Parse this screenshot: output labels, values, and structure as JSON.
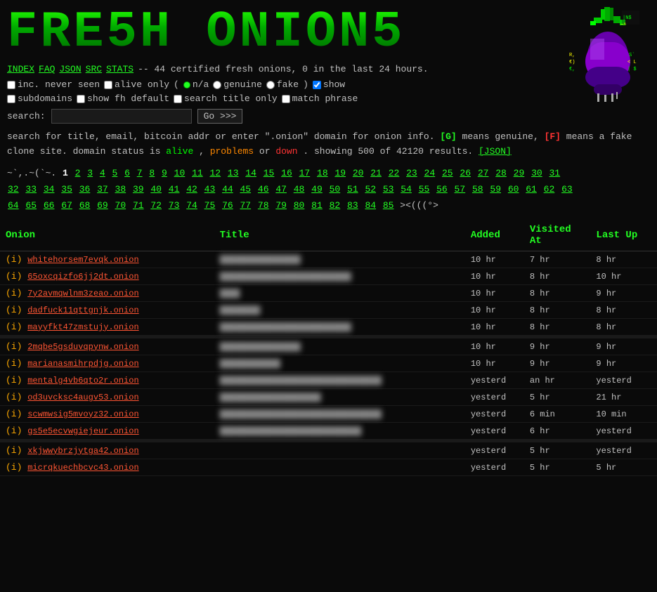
{
  "logo": {
    "text": "FRE5H ONiON5"
  },
  "navbar": {
    "links": [
      "INDEX",
      "FAQ",
      "JSON",
      "SRC",
      "STATS"
    ],
    "info": "-- 44 certified fresh onions, 0 in the last 24 hours."
  },
  "options": {
    "inc_never_seen": false,
    "alive_only": false,
    "radio_na": true,
    "radio_genuine": false,
    "radio_fake": false,
    "show_checked": true,
    "show_label": "show",
    "subdomains_label": "subdomains",
    "show_fh": false,
    "show_fh_label": "show fh default",
    "search_title": false,
    "search_title_label": "search title only",
    "match_phrase": false,
    "match_phrase_label": "match phrase"
  },
  "search": {
    "label": "search:",
    "placeholder": "",
    "value": "",
    "button": "Go >>>"
  },
  "info": {
    "line1": "search for title, email, bitcoin addr or enter \".onion\" domain for onion info.",
    "genuine_badge": "[G]",
    "genuine_desc": "means genuine,",
    "fake_badge": "[F]",
    "fake_desc": "means a fake clone site. domain status is",
    "alive": "alive",
    "problems": "problems",
    "or": "or",
    "down": "down",
    "showing": ". showing 500 of 42120 results.",
    "json_link": "[JSON]"
  },
  "pagination": {
    "prefix": "~`,.~(`~. 1",
    "pages": [
      "2",
      "3",
      "4",
      "5",
      "6",
      "7",
      "8",
      "9",
      "10",
      "11",
      "12",
      "13",
      "14",
      "15",
      "16",
      "17",
      "18",
      "19",
      "20",
      "21",
      "22",
      "23",
      "24",
      "25",
      "26",
      "27",
      "28",
      "29",
      "30",
      "31",
      "32",
      "33",
      "34",
      "35",
      "36",
      "37",
      "38",
      "39",
      "40",
      "41",
      "42",
      "43",
      "44",
      "45",
      "46",
      "47",
      "48",
      "49",
      "50",
      "51",
      "52",
      "53",
      "54",
      "55",
      "56",
      "57",
      "58",
      "59",
      "60",
      "61",
      "62",
      "63",
      "64",
      "65",
      "66",
      "67",
      "68",
      "69",
      "70",
      "71",
      "72",
      "73",
      "74",
      "75",
      "76",
      "77",
      "78",
      "79",
      "80",
      "81",
      "82",
      "83",
      "84",
      "85"
    ],
    "suffix": "><(((°>"
  },
  "table": {
    "headers": [
      "Onion",
      "Title",
      "Added",
      "Visited At",
      "Last Up"
    ],
    "rows": [
      {
        "id": "i1",
        "onion": "whitehorsem7evqk.onion",
        "title_blurred": true,
        "title": "████████████████",
        "added": "10 hr",
        "visited": "7 hr",
        "last_up": "8 hr",
        "status": "alive"
      },
      {
        "id": "i2",
        "onion": "65oxcqizfo6jj2dt.onion",
        "title_blurred": true,
        "title": "██████████████████████████",
        "added": "10 hr",
        "visited": "8 hr",
        "last_up": "10 hr",
        "status": "alive"
      },
      {
        "id": "i3",
        "onion": "7y2avmqwlnm3zeao.onion",
        "title_blurred": true,
        "title": "████",
        "added": "10 hr",
        "visited": "8 hr",
        "last_up": "9 hr",
        "status": "alive"
      },
      {
        "id": "i4",
        "onion": "dadfuck11qttgnjk.onion",
        "title_blurred": true,
        "title": "████████",
        "added": "10 hr",
        "visited": "8 hr",
        "last_up": "8 hr",
        "status": "alive"
      },
      {
        "id": "i5",
        "onion": "mayyfkt47zmstujy.onion",
        "title_blurred": true,
        "title": "██████████████████████████",
        "added": "10 hr",
        "visited": "8 hr",
        "last_up": "8 hr",
        "status": "alive"
      },
      {
        "id": "divider1",
        "divider": true
      },
      {
        "id": "i6",
        "onion": "2mqbe5gsduvqpynw.onion",
        "title_blurred": true,
        "title": "████████████████",
        "added": "10 hr",
        "visited": "9 hr",
        "last_up": "9 hr",
        "status": "alive"
      },
      {
        "id": "i7",
        "onion": "marianasmihrpdjg.onion",
        "title_blurred": true,
        "title": "████████████",
        "added": "10 hr",
        "visited": "9 hr",
        "last_up": "9 hr",
        "status": "alive"
      },
      {
        "id": "i8",
        "onion": "mentalg4vb6qto2r.onion",
        "title_blurred": true,
        "title": "████████████████████████████████",
        "added": "yesterd",
        "visited": "an hr",
        "last_up": "yesterd",
        "status": "alive"
      },
      {
        "id": "i9",
        "onion": "od3uvcksc4augv53.onion",
        "title_blurred": true,
        "title": "████████████████████",
        "added": "yesterd",
        "visited": "5 hr",
        "last_up": "21 hr",
        "status": "alive"
      },
      {
        "id": "i10",
        "onion": "scwmwsig5mvoyz32.onion",
        "title_blurred": true,
        "title": "████████████████████████████████",
        "added": "yesterd",
        "visited": "6 min",
        "last_up": "10 min",
        "status": "alive"
      },
      {
        "id": "i11",
        "onion": "gs5e5ecvwgiejeur.onion",
        "title_blurred": true,
        "title": "████████████████████████████",
        "added": "yesterd",
        "visited": "6 hr",
        "last_up": "yesterd",
        "status": "alive"
      },
      {
        "id": "divider2",
        "divider": true
      },
      {
        "id": "i12",
        "onion": "xkjwwybrzjytga42.onion",
        "title_blurred": true,
        "title": "",
        "added": "yesterd",
        "visited": "5 hr",
        "last_up": "yesterd",
        "status": "alive"
      },
      {
        "id": "i13",
        "onion": "micrqkuechbcvc43.onion",
        "title_blurred": true,
        "title": "",
        "added": "yesterd",
        "visited": "5 hr",
        "last_up": "5 hr",
        "status": "alive"
      }
    ]
  }
}
